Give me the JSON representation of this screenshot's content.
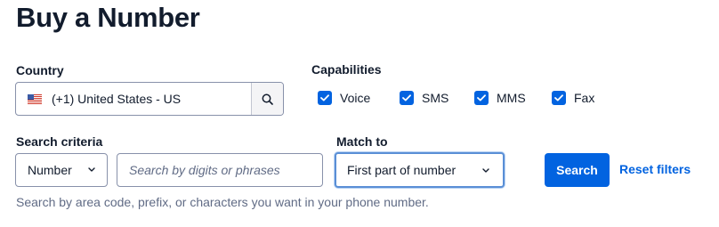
{
  "page": {
    "title": "Buy a Number"
  },
  "country": {
    "label": "Country",
    "flag_icon": "us-flag-icon",
    "value": "(+1) United States - US",
    "search_icon": "search-icon"
  },
  "capabilities": {
    "label": "Capabilities",
    "items": [
      {
        "label": "Voice",
        "checked": true
      },
      {
        "label": "SMS",
        "checked": true
      },
      {
        "label": "MMS",
        "checked": true
      },
      {
        "label": "Fax",
        "checked": true
      }
    ]
  },
  "search_criteria": {
    "label": "Search criteria",
    "selected": "Number",
    "input_placeholder": "Search by digits or phrases",
    "input_value": ""
  },
  "match_to": {
    "label": "Match to",
    "selected": "First part of number"
  },
  "actions": {
    "search_label": "Search",
    "reset_label": "Reset filters"
  },
  "help_text": "Search by area code, prefix, or characters you want in your phone number.",
  "colors": {
    "primary": "#0263e0",
    "text": "#121c2d",
    "muted": "#606b85",
    "border": "#8891aa"
  }
}
